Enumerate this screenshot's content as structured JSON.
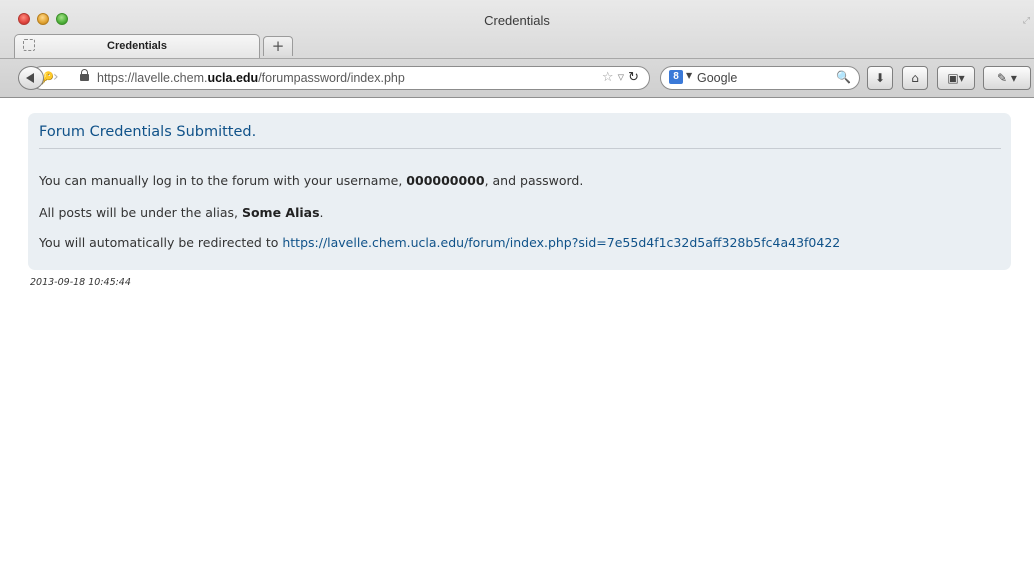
{
  "window": {
    "title": "Credentials"
  },
  "tabs": [
    {
      "label": "Credentials"
    }
  ],
  "new_tab_label": "+",
  "address_bar": {
    "url_prefix": "https://lavelle.chem.",
    "url_host": "ucla.edu",
    "url_suffix": "/forumpassword/index.php"
  },
  "search": {
    "engine": "Google",
    "engine_glyph": "8"
  },
  "page": {
    "heading": "Forum Credentials Submitted.",
    "line1_prefix": "You can manually log in to the forum with your username, ",
    "username": "000000000",
    "line1_suffix": ", and password.",
    "line2_prefix": "All posts will be under the alias, ",
    "alias": "Some Alias",
    "line2_suffix": ".",
    "line3_prefix": "You will automatically be redirected to ",
    "redirect_url": "https://lavelle.chem.ucla.edu/forum/index.php?sid=7e55d4f1c32d5aff328b5fc4a43f0422",
    "timestamp": "2013-09-18 10:45:44"
  },
  "colors": {
    "link": "#105289",
    "panel_bg": "#eaeff3"
  }
}
